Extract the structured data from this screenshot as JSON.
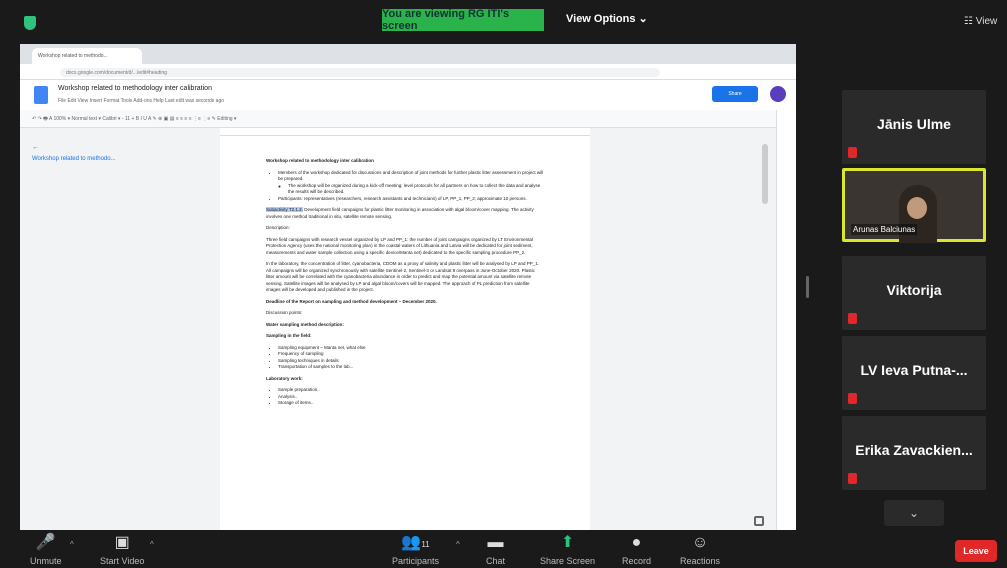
{
  "top": {
    "viewing_banner": "You are viewing RG ITI's screen",
    "view_options": "View Options ⌄",
    "view_button": "☷ View"
  },
  "browser": {
    "tab_title": "Workshop related to methodo...",
    "url": "docs.google.com/document/d/.../edit#heading"
  },
  "doc": {
    "title": "Workshop related to methodology inter calibration",
    "menu": "File   Edit   View   Insert   Format   Tools   Add-ons   Help   Last edit was seconds ago",
    "share_label": "Share",
    "toolbar_text": "↶ ↷ 🖶 A  100% ▾   Normal text ▾   Calibri ▾   - 11 +   B  I  U  A  ✎   ⊕ ▣ ▤   ≡ ≡ ≡ ≡   ⋮≡ ⋮≡   ✎ Editing ▾",
    "outline_back": "←",
    "outline_item": "Workshop related to methodo...",
    "heading": "Workshop related to methodology inter calibration",
    "bullet1": "Members of the workshop dedicated for discussions and description of joint methods for further plastic litter assessment in project will be prepared.",
    "bullet1a": "The workshop will be organized during a kick-off meeting; level protocols for all partners on how to collect the data and analyse the results will be described.",
    "bullet2": "Participants: representatives (researchers, research assistants and technicians) of LP, PP_1, PP_2; approximate 10 persons.",
    "subact_label": "Subactivity T2.1.2.",
    "subact_text": "Development field campaigns for plastic litter monitoring in association with algal bloom/cover mapping. The activity involves one method traditional in situ, satellite remote sensing.",
    "description_label": "Description:",
    "para1": "Three field campaigns with research vessel organized by LP and PP_1: the number of joint campaigns organized by LT Environmental Protection Agency (uses the national monitoring plan) in the coastal waters of Lithuania and Latvia will be dedicated for joint sediment, measurements and water sample collection using a specific device/Manta net) dedicated to the specific sampling procedure PP_2.",
    "para2": "In the laboratory, the concentration of litter, cyanobacteria, CDOM as a proxy of salinity and plastic litter will be analysed by LP and PP_1. All campaigns will be organized synchronously with satellite Sentinel-2, Sentinel-3 or Landsat 8 overpass in June-October 2020. Plastic litter amount will be correlated with the cyanobacteria abundance in order to predict and map the potential amount via satellite remote sensing. Satellite images will be analysed by LP and algal bloom/covers will be mapped. The approach of PL prediction from satellite images will be developed and published in the project.",
    "deadline": "Deadline of the Report on sampling and method development – December 2020.",
    "discussion": "Discussion points:",
    "water": "Water sampling method description:",
    "sampling_field": "Sampling in the field:",
    "f1": "Sampling equipment – Manta net, what else",
    "f2": "Frequency of sampling",
    "f3": "Sampling techniques in details",
    "f4": "Transportation of samples to the lab...",
    "lab": "Laboratory work:",
    "l1": "Sample preparation..",
    "l2": "Analysis..",
    "l3": "Storage of items.."
  },
  "gallery": {
    "p1": "Jānis Ulme",
    "p2_name": "Arunas Balciunas",
    "p3": "Viktorija",
    "p4": "LV Ieva Putna-...",
    "p5": "Erika Zavackien..."
  },
  "controls": {
    "unmute": "Unmute",
    "start_video": "Start Video",
    "participants": "Participants",
    "participants_count": "11",
    "chat": "Chat",
    "share_screen": "Share Screen",
    "record": "Record",
    "reactions": "Reactions",
    "leave": "Leave"
  },
  "colors": {
    "active_speaker": "#d8e62f",
    "viewing_banner": "#29b34a",
    "leave": "#e02828"
  }
}
